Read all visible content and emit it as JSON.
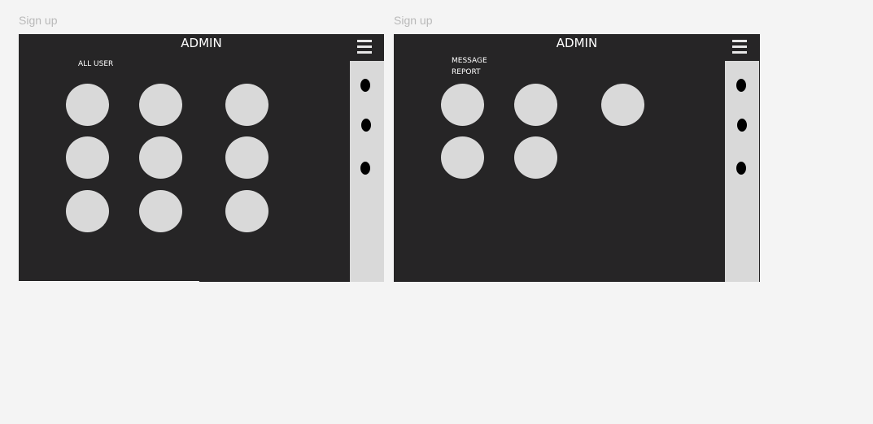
{
  "frames": [
    {
      "label": "Sign up",
      "title": "ADMIN",
      "section_lines": [
        "ALL USER"
      ],
      "tile_count": 9
    },
    {
      "label": "Sign up",
      "title": "ADMIN",
      "section_lines": [
        "MESSAGE",
        "REPORT"
      ],
      "tile_count": 5
    }
  ],
  "icons": {
    "menu": "hamburger-menu-icon",
    "side_items": [
      "dot-icon",
      "dot-icon",
      "dot-icon"
    ]
  },
  "colors": {
    "page_background": "#f4f4f4",
    "frame_background": "#262526",
    "tile": "#d9d9d9",
    "side_panel": "#d9d9d9",
    "title_text": "#ffffff",
    "frame_label": "#b9b9b9"
  }
}
